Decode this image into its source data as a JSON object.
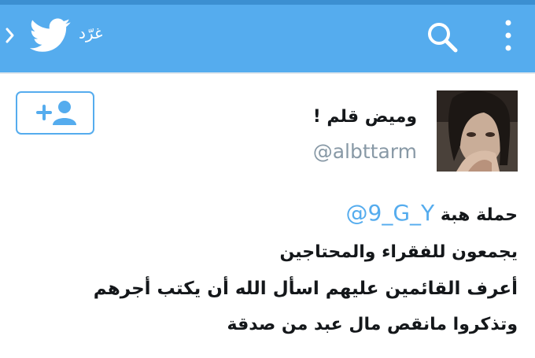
{
  "topbar": {
    "tweet_label": "غرّد",
    "colors": {
      "bar": "#55acee",
      "accent": "#3b8fd1"
    },
    "icons": [
      "chevron-right-icon",
      "twitter-bird-icon",
      "search-icon",
      "more-vertical-icon"
    ]
  },
  "profile": {
    "display_name": "وميض قلم !",
    "handle": "@albttarm",
    "follow_icon": "add-user-icon"
  },
  "tweet": {
    "line1_prefix": "حملة هبة",
    "mention": "@9_G_Y",
    "line2": "يجمعون للفقراء والمحتاجين",
    "line3": "أعرف القائمين عليهم اسأل الله أن يكتب أجرهم",
    "line4": "وتذكروا مانقص مال عبد من صدقة"
  }
}
